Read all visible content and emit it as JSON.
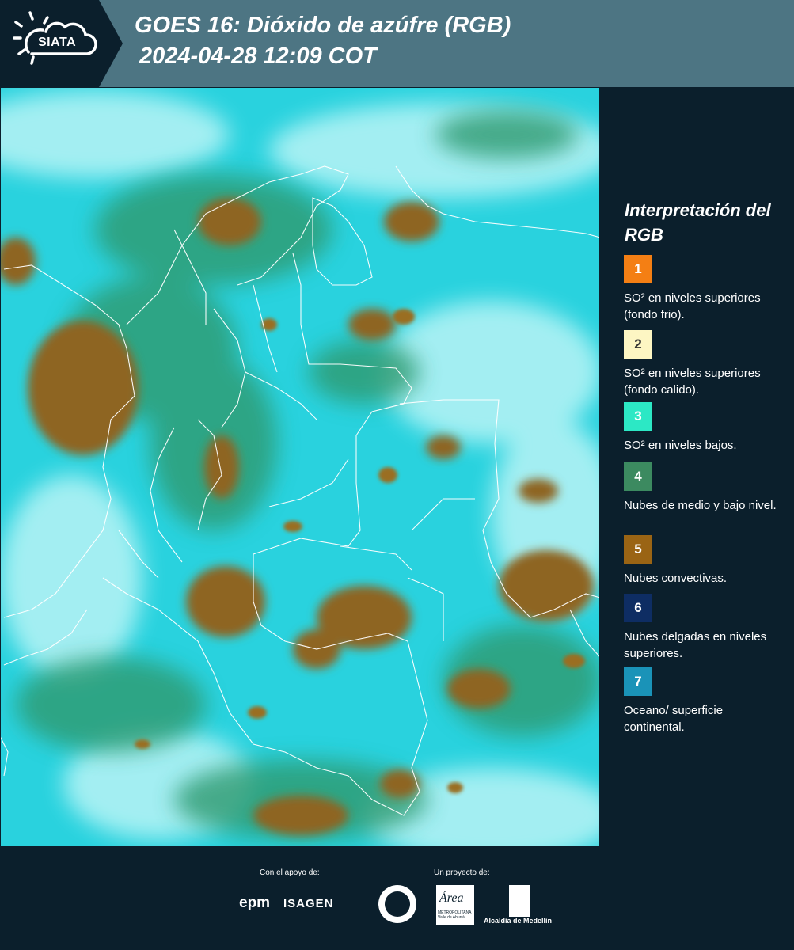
{
  "header": {
    "logo_text": "SIATA",
    "title": "GOES 16: Dióxido de azúfre (RGB)",
    "subtitle": "2024-04-28 12:09 COT"
  },
  "legend": {
    "title": "Interpretación del RGB",
    "items": [
      {
        "number": "1",
        "color": "#f47f14",
        "text": "SO² en niveles superiores (fondo frio)."
      },
      {
        "number": "2",
        "color": "#fdf6c3",
        "text": "SO² en niveles superiores (fondo calido)."
      },
      {
        "number": "3",
        "color": "#2ce8c5",
        "text": "SO² en niveles bajos."
      },
      {
        "number": "4",
        "color": "#3c8a60",
        "text": "Nubes de medio y bajo nivel."
      },
      {
        "number": "5",
        "color": "#9a6414",
        "text": "Nubes convectivas."
      },
      {
        "number": "6",
        "color": "#0e2d63",
        "text": "Nubes delgadas en niveles superiores."
      },
      {
        "number": "7",
        "color": "#1a93b8",
        "text": "Oceano/ superficie continental."
      }
    ]
  },
  "footer": {
    "support_label": "Con el apoyo de:",
    "project_label": "Un proyecto de:",
    "epm": "epm",
    "isagen": "ISAGEN",
    "area_metropolitana": "Área",
    "area_sub": "METROPOLITANA Valle de Aburrá",
    "alcaldia": "Alcaldía de Medellín"
  }
}
